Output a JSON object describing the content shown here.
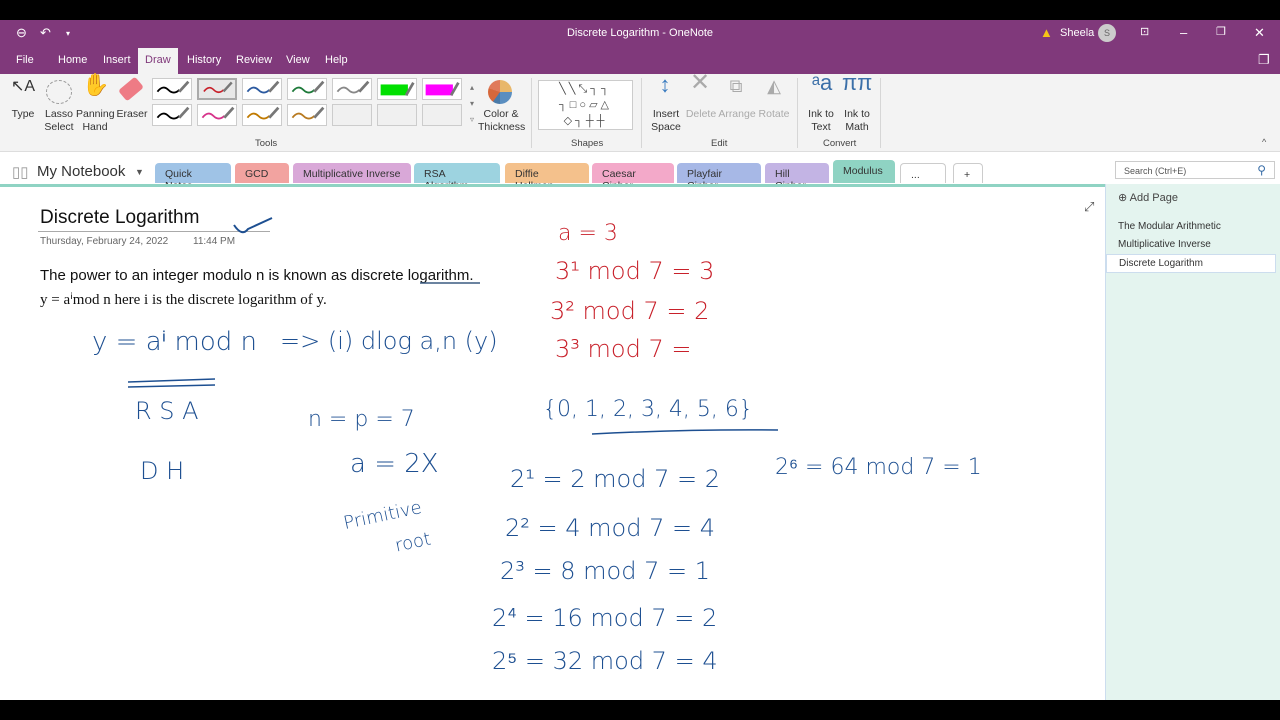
{
  "window": {
    "title": "Discrete Logarithm  -  OneNote",
    "user": "Sheela",
    "avatar": "S"
  },
  "menu": [
    "File",
    "Home",
    "Insert",
    "Draw",
    "History",
    "Review",
    "View",
    "Help"
  ],
  "ribbon": {
    "tools": {
      "type": "Type",
      "lasso": "Lasso Select",
      "pan": "Panning Hand",
      "eraser": "Eraser",
      "color": "Color & Thickness",
      "group": "Tools"
    },
    "pens": [
      "#000000",
      "#c8202a",
      "#2c5aa0",
      "#1e7a3a",
      "#888888",
      "#00e000",
      "#ff00ff",
      "#000000",
      "#d6338a",
      "#c07a00",
      "#b87a20"
    ],
    "shapes": {
      "group": "Shapes"
    },
    "edit": {
      "insert_space": "Insert Space",
      "delete": "Delete",
      "arrange": "Arrange",
      "rotate": "Rotate",
      "group": "Edit"
    },
    "convert": {
      "ink_text": "Ink to Text",
      "ink_math": "Ink to Math",
      "group": "Convert"
    }
  },
  "notebook": "My Notebook",
  "sections": [
    {
      "label": "Quick Notes",
      "color": "#9fc3e6"
    },
    {
      "label": "GCD",
      "color": "#f2a3a0"
    },
    {
      "label": "Multiplicative Inverse",
      "color": "#d9a8d8"
    },
    {
      "label": "RSA Algorithm",
      "color": "#9dd3e0"
    },
    {
      "label": "Diffie Hellman",
      "color": "#f4c18c"
    },
    {
      "label": "Caesar Cipher",
      "color": "#f3a9c9"
    },
    {
      "label": "Playfair Cipher",
      "color": "#a7b8e6"
    },
    {
      "label": "Hill Cipher",
      "color": "#c3b4e4"
    },
    {
      "label": "Modulus",
      "color": "#8fd3c3"
    },
    {
      "label": "...",
      "color": "#ffffff"
    },
    {
      "label": "+",
      "color": "#ffffff"
    }
  ],
  "search_placeholder": "Search (Ctrl+E)",
  "pages": {
    "add": "Add Page",
    "items": [
      "The Modular Arithmetic",
      "Multiplicative Inverse",
      "Discrete Logarithm"
    ]
  },
  "note": {
    "title": "Discrete Logarithm",
    "date": "Thursday, February 24, 2022",
    "time": "11:44 PM",
    "line1": "The power to an integer modulo n is known as discrete logarithm.",
    "line2": "y =  aⁱmod n here i is the discrete logarithm of y."
  },
  "ink": {
    "red": [
      "a = 3",
      "3¹ mod 7 = 3",
      "3² mod 7 = 2",
      "3³ mod 7 ="
    ],
    "blue": [
      "y = aⁱ mod n",
      "=> (i) dlog a,n (y)",
      "R S A",
      "D H",
      "n = p =  7",
      "a = 2X",
      "Primitive",
      "root",
      "{0, 1, 2, 3, 4, 5, 6}",
      "2¹ = 2 mod 7 = 2",
      "2² = 4 mod 7 = 4",
      "2³ = 8 mod 7 = 1",
      "2⁴ = 16 mod 7 = 2",
      "2⁵ = 32 mod 7 = 4",
      "2⁶ = 64  mod 7 = 1"
    ]
  }
}
